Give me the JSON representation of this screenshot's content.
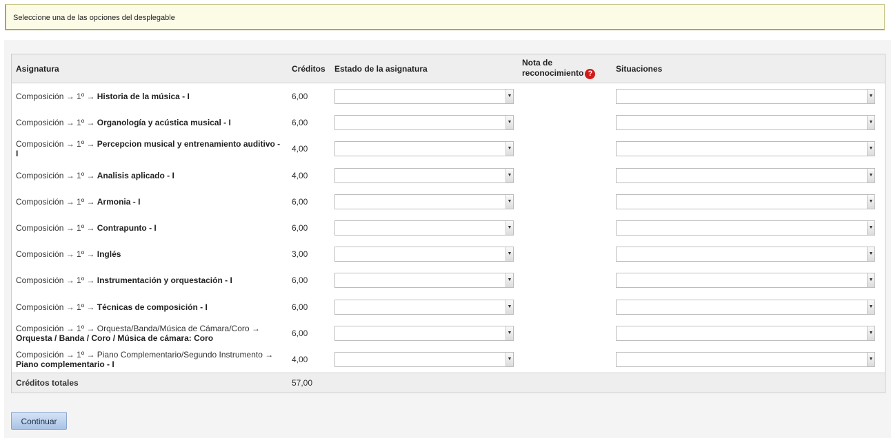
{
  "notice": {
    "text": "Seleccione una de las opciones del desplegable"
  },
  "table": {
    "headers": {
      "subject": "Asignatura",
      "credits": "Créditos",
      "state": "Estado de la asignatura",
      "note_line1": "Nota de",
      "note_line2": "reconocimiento",
      "situations": "Situaciones"
    },
    "help_icon": "question-circle-icon",
    "rows": [
      {
        "path": "Composición → 1º → ",
        "name": "Historia de la música - I",
        "credits": "6,00"
      },
      {
        "path": "Composición → 1º → ",
        "name": "Organología y acústica musical - I",
        "credits": "6,00"
      },
      {
        "path": "Composición → 1º → ",
        "name": "Percepcion musical y entrenamiento auditivo - I",
        "credits": "4,00"
      },
      {
        "path": "Composición → 1º → ",
        "name": "Analisis aplicado - I",
        "credits": "4,00"
      },
      {
        "path": "Composición → 1º → ",
        "name": "Armonia - I",
        "credits": "6,00"
      },
      {
        "path": "Composición → 1º → ",
        "name": "Contrapunto - I",
        "credits": "6,00"
      },
      {
        "path": "Composición → 1º → ",
        "name": "Inglés",
        "credits": "3,00"
      },
      {
        "path": "Composición → 1º → ",
        "name": "Instrumentación y orquestación - I",
        "credits": "6,00"
      },
      {
        "path": "Composición → 1º → ",
        "name": "Técnicas de composición - I",
        "credits": "6,00"
      },
      {
        "path": "Composición → 1º → Orquesta/Banda/Música de Cámara/Coro → ",
        "name": "Orquesta / Banda / Coro / Música de cámara: Coro",
        "credits": "6,00"
      },
      {
        "path": "Composición → 1º → Piano Complementario/Segundo Instrumento → ",
        "name": "Piano complementario - I",
        "credits": "4,00"
      }
    ],
    "total": {
      "label": "Créditos totales",
      "value": "57,00"
    }
  },
  "actions": {
    "continue_label": "Continuar"
  },
  "colors": {
    "notice_bg": "#fbfbe6",
    "help_icon": "#d11a1a",
    "button_bg": "#a9c3e6"
  }
}
